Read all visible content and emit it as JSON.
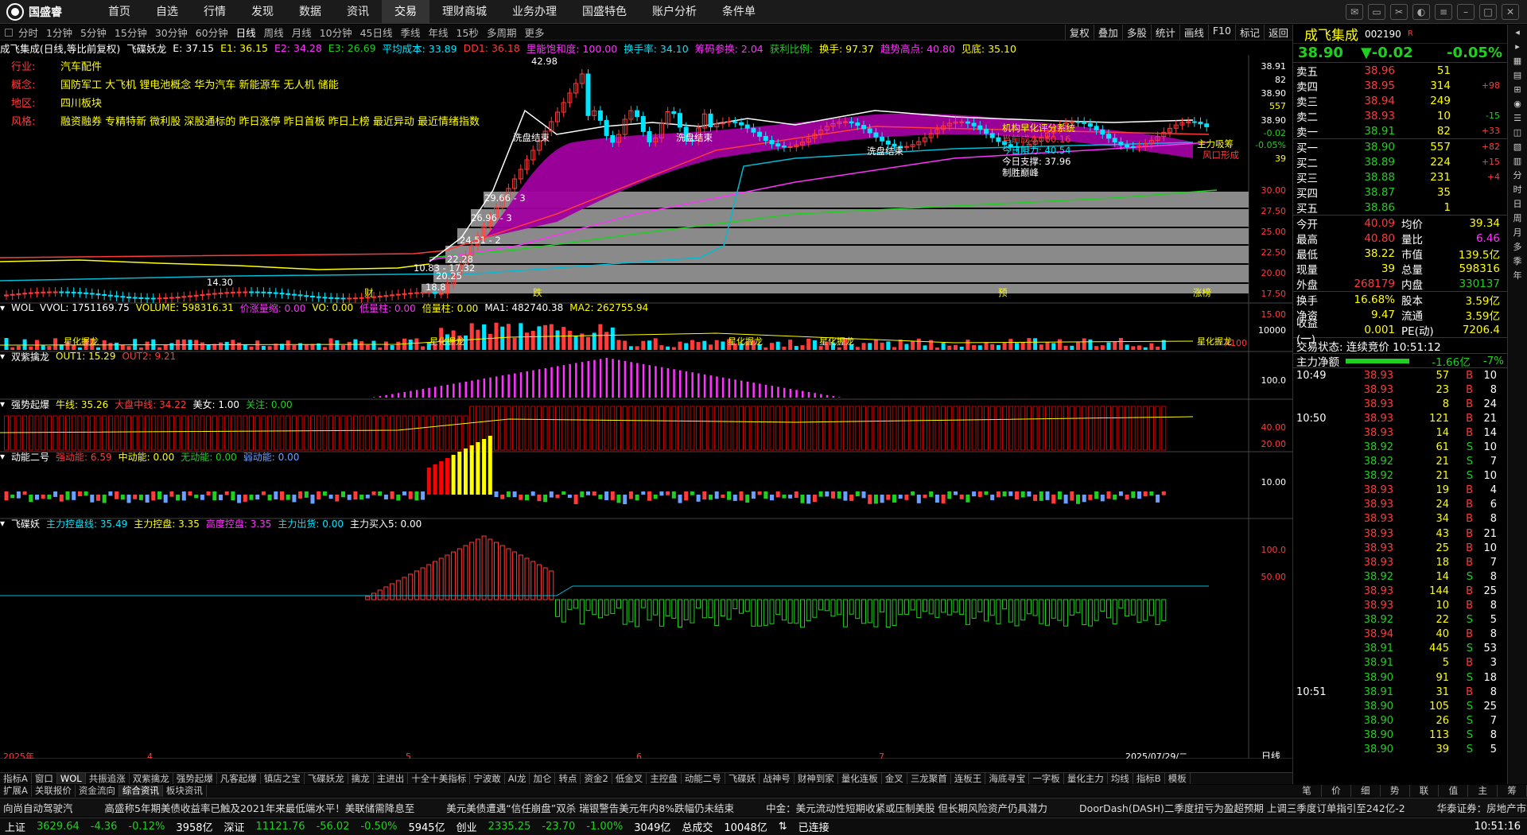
{
  "app": {
    "brand": "国盛睿"
  },
  "menu": [
    "首页",
    "自选",
    "行情",
    "发现",
    "数据",
    "资讯",
    "交易",
    "理财商城",
    "业务办理",
    "国盛特色",
    "账户分析",
    "条件单"
  ],
  "menu_active": 6,
  "periods": [
    "分时",
    "1分钟",
    "5分钟",
    "15分钟",
    "30分钟",
    "60分钟",
    "日线",
    "周线",
    "月线",
    "10分钟",
    "45日线",
    "季线",
    "年线",
    "15秒",
    "多周期",
    "更多"
  ],
  "period_active": "日线",
  "right_tools": [
    "复权",
    "叠加",
    "多股",
    "统计",
    "画线",
    "F10",
    "标记",
    "返回"
  ],
  "title": {
    "name": "成飞集成(日线,等比前复权)",
    "ind": "飞碟妖龙",
    "e": "E: 37.15",
    "e1": "E1: 36.15",
    "e2": "E2: 34.28",
    "e3": "E3: 26.69",
    "avgcost": "平均成本: 33.89",
    "dd1": "DD1: 36.18",
    "saturation": "里能饱和度: 100.00",
    "turnover": "换手率: 34.10",
    "chips": "筹码参换: 2.04",
    "profit": "获利比例: ",
    "hsw": "换手: 97.37",
    "trend": "趋势高点: 40.80",
    "jd": "见底: 35.10"
  },
  "info": [
    {
      "k": "行业:",
      "v": "汽车配件"
    },
    {
      "k": "概念:",
      "v": "国防军工 大飞机 锂电池概念 华为汽车 新能源车 无人机 储能"
    },
    {
      "k": "地区:",
      "v": "四川板块"
    },
    {
      "k": "风格:",
      "v": "融资融券 专精特新 微利股 深股通标的 昨日涨停 昨日首板 昨日上榜 最近异动 最近情绪指数"
    }
  ],
  "price_axis": [
    "38.91",
    "82",
    "38.90",
    "557",
    "38.90",
    "-0.02",
    "-0.05%",
    "39",
    "30.00",
    "27.50",
    "25.00",
    "22.50",
    "20.00",
    "17.50",
    "15.00"
  ],
  "chart_labels": {
    "high": "42.98",
    "low": "14.30",
    "range": "10.83 - 17.32",
    "xp1": "洗盘结束",
    "xp2": "洗盘结束",
    "xp3": "洗盘结束",
    "jg": "机构早化评分系统",
    "now_cost": "当前成本: 60.16",
    "zz": "今日阻力: 40.54",
    "zc": "今日支撑: 37.96",
    "zs": "制胜巅峰",
    "main": "主力吸筹",
    "risk": "风口形成",
    "band1": "29.66 - 3",
    "band2": "26.96 - 3",
    "band3": "24.51 - 2",
    "band4": "22.28",
    "band5": "20.25",
    "band6": "18.8",
    "cai": "财",
    "die": "跌",
    "yu": "预",
    "zhang": "涨榜"
  },
  "ind1": {
    "t": "WOL",
    "vvol": "VVOL: 1751169.75",
    "volume": "VOLUME: 598316.31",
    "jl": "价涨量缩: 0.00",
    "vo": "VO: 0.00",
    "dlz": "低量柱: 0.00",
    "blz": "倍量柱: 0.00",
    "ma1": "MA1: 482740.38",
    "ma2": "MA2: 262755.94",
    "axis": "10000",
    "x100": "X100",
    "tag": "星化握龙"
  },
  "ind2": {
    "t": "双紫擒龙",
    "out1": "OUT1: 15.29",
    "out2": "OUT2: 9.21",
    "axis": "100.0"
  },
  "ind3": {
    "t": "强势起爆",
    "nx": "牛线: 35.26",
    "dp": "大盘中线: 34.22",
    "mn": "美女: 1.00",
    "gz": "关注: 0.00",
    "a1": "40.00",
    "a2": "20.00"
  },
  "ind4": {
    "t": "动能二号",
    "q": "强动能: 6.59",
    "z": "中动能: 0.00",
    "w": "无动能: 0.00",
    "r": "弱动能: 0.00",
    "axis": "10.00"
  },
  "ind5": {
    "t": "飞碟妖",
    "zl": "主力控盘线: 35.49",
    "zk": "主力控盘: 3.35",
    "gd": "高度控盘: 3.35",
    "cc": "主力出货: 0.00",
    "mr": "主力买入5: 0.00",
    "a1": "100.0",
    "a2": "50.00"
  },
  "dates": [
    "2025年",
    "4",
    "5",
    "6",
    "7",
    "2025/07/29/二"
  ],
  "date_axis_label": "日线",
  "tabs1": [
    "指标A",
    "窗口",
    "WOL",
    "共振追涨",
    "双紫擒龙",
    "强势起爆",
    "凡客起爆",
    "镇店之宝",
    "飞碟妖龙",
    "擒龙",
    "主进出",
    "十全十美指标",
    "宁波敢",
    "AI龙",
    "加仑",
    "转点",
    "资金2",
    "低金叉",
    "主控盘",
    "动能二号",
    "飞碟妖",
    "战神号",
    "财神到家",
    "量化连板",
    "金叉",
    "三龙聚首",
    "连板王",
    "海底寻宝",
    "一字板",
    "量化主力",
    "均线",
    "指标B",
    "模板"
  ],
  "tabs2": [
    "扩展A",
    "关联报价",
    "资金流向",
    "综合资讯",
    "板块资讯"
  ],
  "rp": {
    "name": "成飞集成",
    "code": "002190",
    "tag": "R",
    "price": "38.90",
    "chg": "▼-0.02",
    "pct": "-0.05%",
    "asks": [
      {
        "l": "卖五",
        "p": "38.96",
        "v": "51",
        "d": ""
      },
      {
        "l": "卖四",
        "p": "38.95",
        "v": "314",
        "d": "+98"
      },
      {
        "l": "卖三",
        "p": "38.94",
        "v": "249",
        "d": ""
      },
      {
        "l": "卖二",
        "p": "38.93",
        "v": "10",
        "d": "-15"
      },
      {
        "l": "卖一",
        "p": "38.91",
        "v": "82",
        "d": "+33"
      }
    ],
    "bids": [
      {
        "l": "买一",
        "p": "38.90",
        "v": "557",
        "d": "+82"
      },
      {
        "l": "买二",
        "p": "38.89",
        "v": "224",
        "d": "+15"
      },
      {
        "l": "买三",
        "p": "38.88",
        "v": "231",
        "d": "+4"
      },
      {
        "l": "买四",
        "p": "38.87",
        "v": "35",
        "d": ""
      },
      {
        "l": "买五",
        "p": "38.86",
        "v": "1",
        "d": ""
      }
    ],
    "stats": [
      [
        "今开",
        "40.09",
        "均价",
        "39.34"
      ],
      [
        "最高",
        "40.80",
        "量比",
        "6.46"
      ],
      [
        "最低",
        "38.22",
        "市值",
        "139.5亿"
      ],
      [
        "现量",
        "39",
        "总量",
        "598316"
      ],
      [
        "外盘",
        "268179",
        "内盘",
        "330137"
      ]
    ],
    "stats2": [
      [
        "换手",
        "16.68%",
        "股本",
        "3.59亿"
      ],
      [
        "净资",
        "9.47",
        "流通",
        "3.59亿"
      ],
      [
        "收益(一)",
        "0.001",
        "PE(动)",
        "7206.4"
      ]
    ],
    "status": "交易状态: 连续竞价  10:51:12",
    "net_label": "主力净额",
    "net_val": "-1.66亿",
    "net_pct": "-7%",
    "ticks": [
      [
        "10:49",
        "38.93",
        "57",
        "B",
        "10"
      ],
      [
        "",
        "38.93",
        "23",
        "B",
        "8"
      ],
      [
        "",
        "38.93",
        "8",
        "B",
        "24"
      ],
      [
        "10:50",
        "38.93",
        "121",
        "B",
        "21"
      ],
      [
        "",
        "38.93",
        "14",
        "B",
        "14"
      ],
      [
        "",
        "38.92",
        "61",
        "S",
        "10"
      ],
      [
        "",
        "38.92",
        "21",
        "S",
        "7"
      ],
      [
        "",
        "38.92",
        "21",
        "S",
        "10"
      ],
      [
        "",
        "38.93",
        "19",
        "B",
        "4"
      ],
      [
        "",
        "38.93",
        "24",
        "B",
        "6"
      ],
      [
        "",
        "38.93",
        "34",
        "B",
        "8"
      ],
      [
        "",
        "38.93",
        "43",
        "B",
        "21"
      ],
      [
        "",
        "38.93",
        "25",
        "B",
        "10"
      ],
      [
        "",
        "38.93",
        "18",
        "B",
        "7"
      ],
      [
        "",
        "38.92",
        "14",
        "S",
        "8"
      ],
      [
        "",
        "38.93",
        "144",
        "B",
        "25"
      ],
      [
        "",
        "38.93",
        "10",
        "B",
        "8"
      ],
      [
        "",
        "38.92",
        "22",
        "S",
        "5"
      ],
      [
        "",
        "38.94",
        "40",
        "B",
        "8"
      ],
      [
        "",
        "38.91",
        "445",
        "S",
        "53"
      ],
      [
        "",
        "38.91",
        "5",
        "B",
        "3"
      ],
      [
        "",
        "38.90",
        "91",
        "S",
        "18"
      ],
      [
        "10:51",
        "38.91",
        "31",
        "B",
        "8"
      ],
      [
        "",
        "38.90",
        "105",
        "S",
        "25"
      ],
      [
        "",
        "38.90",
        "26",
        "S",
        "7"
      ],
      [
        "",
        "38.90",
        "113",
        "S",
        "8"
      ],
      [
        "",
        "38.90",
        "39",
        "S",
        "5"
      ]
    ],
    "bottom_tabs": [
      "笔",
      "价",
      "细",
      "势",
      "联",
      "值",
      "主",
      "筹"
    ]
  },
  "sidebar": [
    "分",
    "时",
    "日",
    "周",
    "月",
    "多",
    "季",
    "年"
  ],
  "news": [
    "向尚自动驾驶汽",
    "高盛称5年期美债收益率已触及2021年来最低端水平！美联储需降息至",
    "美元美债遭遇“信任崩盘”双杀 瑞银警告美元年内8%跌幅仍未结束",
    "中金：美元流动性短期收紧或压制美股 但长期风险资产仍具潜力",
    "DoorDash(DASH)二季度扭亏为盈超预期 上调三季度订单指引至242亿-2",
    "华泰证券：房地产市场中长期"
  ],
  "status": {
    "sh_l": "上证",
    "sh": "3629.64",
    "sh_c": "-4.36",
    "sh_p": "-0.12%",
    "sh_v": "3958亿",
    "sz_l": "深证",
    "sz": "11121.76",
    "sz_c": "-56.02",
    "sz_p": "-0.50%",
    "sz_v": "5945亿",
    "cy_l": "创业",
    "cy": "2335.25",
    "cy_c": "-23.70",
    "cy_p": "-1.00%",
    "cy_v": "3049亿",
    "tot_l": "总成交",
    "tot": "10048亿",
    "conn": "已连接",
    "time": "10:51:16"
  },
  "colors": {
    "up": "#ff3b3b",
    "down": "#20d020",
    "accent": "#ffff00",
    "cyan": "#00e5ff",
    "magenta": "#ff33ff"
  }
}
